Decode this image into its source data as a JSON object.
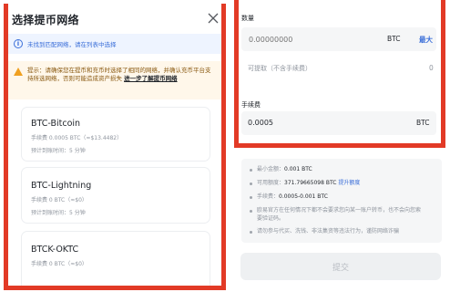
{
  "modal": {
    "title": "选择提币网络",
    "info": "未找到匹配网络，请在列表中选择",
    "warning_text": "提示：请确保您在提币和充币时选择了相同的网络，并确认充币平台支持所选网络，否则可能造成资产损失",
    "warning_link": "进一步了解提币网络",
    "networks": [
      {
        "name": "BTC-Bitcoin",
        "fee": "手续费 0.0005 BTC（≈$13.4482）",
        "time": "预计到账时间：5 分钟"
      },
      {
        "name": "BTC-Lightning",
        "fee": "手续费 0 BTC（≈$0）",
        "time": "预计到账时间：5 分钟"
      },
      {
        "name": "BTCK-OKTC",
        "fee": "手续费 0 BTC（≈$0）",
        "time": ""
      }
    ]
  },
  "form": {
    "quantity_label": "数量",
    "amount_placeholder": "0.00000000",
    "unit": "BTC",
    "max_label": "最大",
    "available_label": "可提取（不含手续费）",
    "available_value": "0",
    "fee_label": "手续费",
    "fee_value": "0.0005",
    "fee_unit": "BTC"
  },
  "notes": {
    "min_label": "最小金额：",
    "min_value": "0.001 BTC",
    "limit_label": "可用额度：",
    "limit_value": "371.79665098 BTC",
    "limit_link": "提升额度",
    "fee_label": "手续费：",
    "fee_value": "0.0005-0.001 BTC",
    "official_text": "欧易官方在任何情况下都不会要求您向某一账户转币，也不会向您索要验证码。",
    "warning_text": "请勿参与代买、洗钱、非法集资等违法行为，谨防网络诈骗"
  },
  "submit_label": "提交"
}
